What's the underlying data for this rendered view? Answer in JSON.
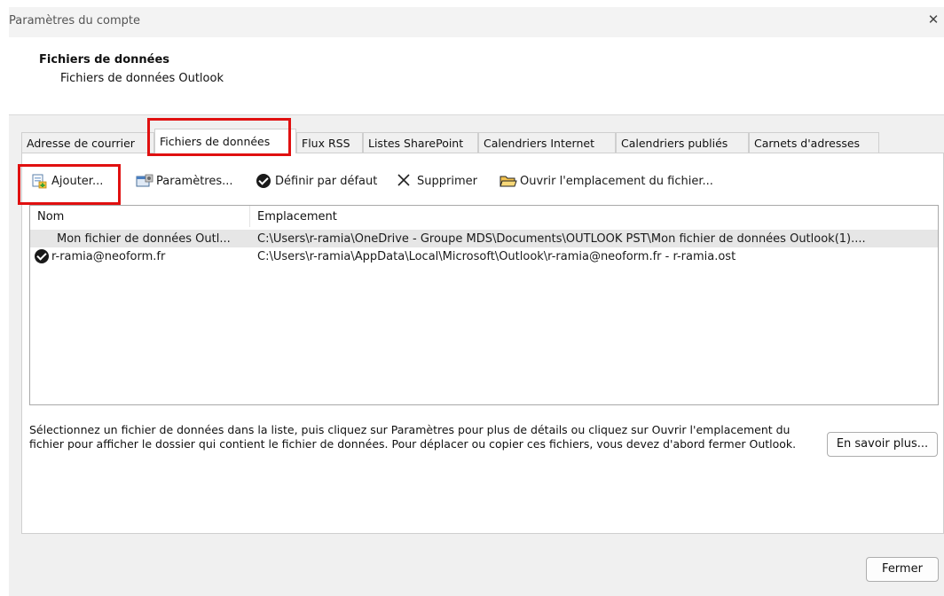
{
  "window": {
    "title": "Paramètres du compte",
    "close_glyph": "✕"
  },
  "header": {
    "title": "Fichiers de données",
    "subtitle": "Fichiers de données Outlook"
  },
  "tabs": [
    {
      "label": "Adresse de courrier"
    },
    {
      "label": "Fichiers de données",
      "active": true
    },
    {
      "label": "Flux RSS"
    },
    {
      "label": "Listes SharePoint"
    },
    {
      "label": "Calendriers Internet"
    },
    {
      "label": "Calendriers publiés"
    },
    {
      "label": "Carnets d'adresses"
    }
  ],
  "toolbar": {
    "add_label": "Ajouter...",
    "settings_label": "Paramètres...",
    "default_label": "Définir par défaut",
    "remove_label": "Supprimer",
    "open_location_label": "Ouvrir l'emplacement du fichier..."
  },
  "list": {
    "columns": [
      "Nom",
      "Emplacement"
    ],
    "rows": [
      {
        "name": "Mon fichier de données Outl...",
        "location": "C:\\Users\\r-ramia\\OneDrive - Groupe MDS\\Documents\\OUTLOOK PST\\Mon fichier de données Outlook(1)....",
        "default": false,
        "selected": true
      },
      {
        "name": "r-ramia@neoform.fr",
        "location": "C:\\Users\\r-ramia\\AppData\\Local\\Microsoft\\Outlook\\r-ramia@neoform.fr - r-ramia.ost",
        "default": true,
        "selected": false
      }
    ]
  },
  "description": "Sélectionnez un fichier de données dans la liste, puis cliquez sur Paramètres pour plus de détails ou cliquez sur Ouvrir l'emplacement du fichier pour afficher le dossier qui contient le fichier de données. Pour déplacer ou copier ces fichiers, vous devez d'abord fermer Outlook.",
  "buttons": {
    "learn_more": "En savoir plus...",
    "close": "Fermer"
  },
  "colors": {
    "highlight": "#e01010",
    "selected_row": "#e6e6e6",
    "dialog_bg": "#f0f0f0"
  },
  "icons": {
    "add": "add-data-file-icon",
    "settings": "settings-icon",
    "default": "checkmark-circle-icon",
    "remove": "x-delete-icon",
    "open": "folder-open-icon"
  }
}
